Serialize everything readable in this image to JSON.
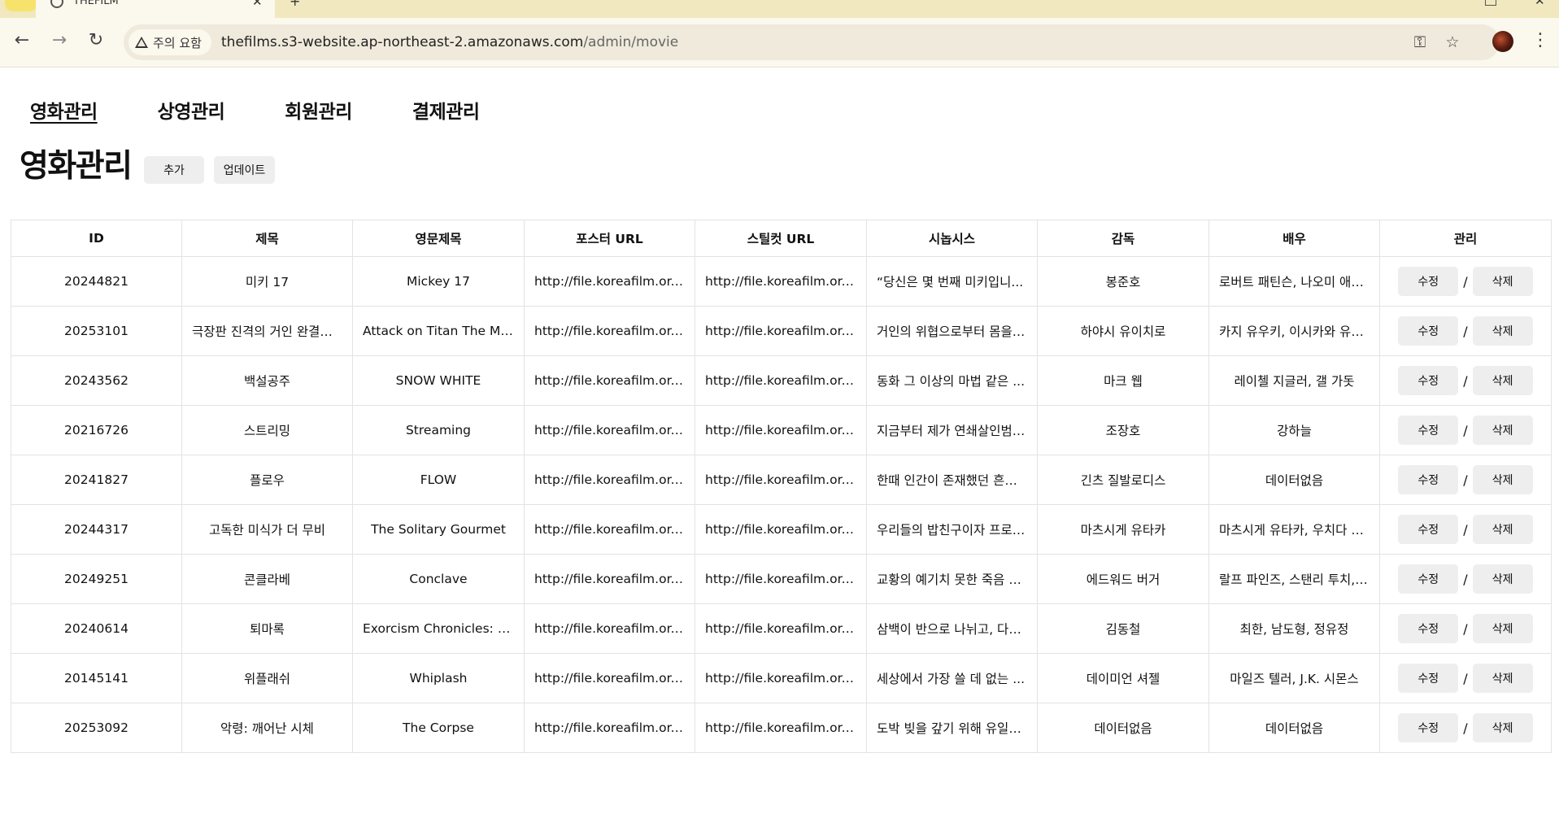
{
  "browser": {
    "tab_title": "THEFILM",
    "warning": "주의 요함",
    "url_host": "thefilms.s3-website.ap-northeast-2.amazonaws.com",
    "url_path": "/admin/movie"
  },
  "nav": [
    "영화관리",
    "상영관리",
    "회원관리",
    "결제관리"
  ],
  "page": {
    "title": "영화관리",
    "add_label": "추가",
    "update_label": "업데이트"
  },
  "table": {
    "columns": [
      "ID",
      "제목",
      "영문제목",
      "포스터 URL",
      "스틸컷 URL",
      "시놉시스",
      "감독",
      "배우",
      "관리"
    ],
    "edit_label": "수정",
    "delete_label": "삭제",
    "separator": "/",
    "rows": [
      [
        "20244821",
        "미키 17",
        "Mickey 17",
        "http://file.koreafilm.or.k...",
        "http://file.koreafilm.or.k...",
        "“당신은 몇 번째 미키입니...",
        "봉준호",
        "로버트 패틴슨, 나오미 애키..."
      ],
      [
        "20253101",
        "극장판 진격의 거인 완결편 ...",
        "Attack on Titan The Mo...",
        "http://file.koreafilm.or.k...",
        "http://file.koreafilm.or.k...",
        "거인의 위협으로부터 몸을 ...",
        "하야시 유이치로",
        "카지 유우키, 이시카와 유이..."
      ],
      [
        "20243562",
        "백설공주",
        "SNOW WHITE",
        "http://file.koreafilm.or.k...",
        "http://file.koreafilm.or.k...",
        "동화 그 이상의 마법 같은 ...",
        "마크 웹",
        "레이첼 지글러, 갤 가돗"
      ],
      [
        "20216726",
        "스트리밍",
        "Streaming",
        "http://file.koreafilm.or.k...",
        "http://file.koreafilm.or.k...",
        "지금부터 제가 연쇄살인범 ...",
        "조장호",
        "강하늘"
      ],
      [
        "20241827",
        "플로우",
        "FLOW",
        "http://file.koreafilm.or.k...",
        "http://file.koreafilm.or.k...",
        "한때 인간이 존재했던 흔적...",
        "긴츠 질발로디스",
        "데이터없음"
      ],
      [
        "20244317",
        "고독한 미식가 더 무비",
        "The Solitary Gourmet",
        "http://file.koreafilm.or.k...",
        "http://file.koreafilm.or.k...",
        "우리들의 밥친구이자 프로 ...",
        "마츠시게 유타카",
        "마츠시게 유타카, 우치다 유..."
      ],
      [
        "20249251",
        "콘클라베",
        "Conclave",
        "http://file.koreafilm.or.k...",
        "http://file.koreafilm.or.k...",
        "교황의 예기치 못한 죽음 이...",
        "에드워드 버거",
        "랄프 파인즈, 스탠리 투치, ..."
      ],
      [
        "20240614",
        "퇴마록",
        "Exorcism Chronicles: T...",
        "http://file.koreafilm.or.k...",
        "http://file.koreafilm.or.k...",
        "삼백이 반으로 나뉘고, 다섯...",
        "김동철",
        "최한, 남도형, 정유정"
      ],
      [
        "20145141",
        "위플래쉬",
        "Whiplash",
        "http://file.koreafilm.or.k...",
        "http://file.koreafilm.or.k...",
        "세상에서 가장 쓸 데 없는 ...",
        "데이미언 셔젤",
        "마일즈 텔러, J.K. 시몬스"
      ],
      [
        "20253092",
        "악령: 깨어난 시체",
        "The Corpse",
        "http://file.koreafilm.or.k...",
        "http://file.koreafilm.or.k...",
        "도박 빚을 갚기 위해 유일한...",
        "데이터없음",
        "데이터없음"
      ]
    ]
  }
}
